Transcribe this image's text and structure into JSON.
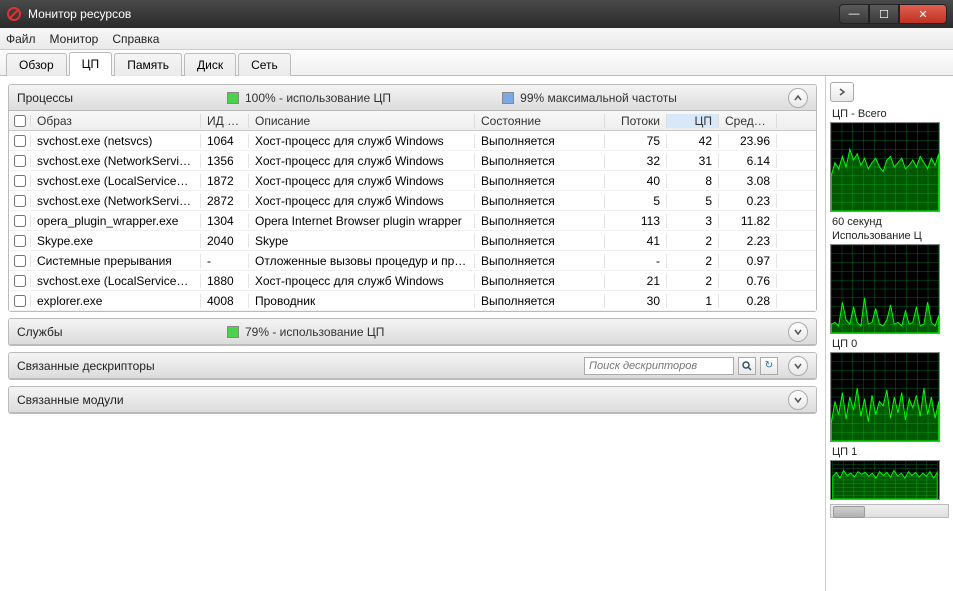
{
  "window": {
    "title": "Монитор ресурсов"
  },
  "menu": {
    "file": "Файл",
    "monitor": "Монитор",
    "help": "Справка"
  },
  "tabs": {
    "overview": "Обзор",
    "cpu": "ЦП",
    "memory": "Память",
    "disk": "Диск",
    "network": "Сеть"
  },
  "panels": {
    "processes": {
      "title": "Процессы",
      "stat1": "100% - использование ЦП",
      "stat2": "99% максимальной частоты",
      "columns": {
        "image": "Образ",
        "pid": "ИД п...",
        "desc": "Описание",
        "state": "Состояние",
        "threads": "Потоки",
        "cpu": "ЦП",
        "avg": "Средн..."
      },
      "rows": [
        {
          "image": "svchost.exe (netsvcs)",
          "pid": "1064",
          "desc": "Хост-процесс для служб Windows",
          "state": "Выполняется",
          "threads": "75",
          "cpu": "42",
          "avg": "23.96"
        },
        {
          "image": "svchost.exe (NetworkService)",
          "pid": "1356",
          "desc": "Хост-процесс для служб Windows",
          "state": "Выполняется",
          "threads": "32",
          "cpu": "31",
          "avg": "6.14"
        },
        {
          "image": "svchost.exe (LocalServiceAn...",
          "pid": "1872",
          "desc": "Хост-процесс для служб Windows",
          "state": "Выполняется",
          "threads": "40",
          "cpu": "8",
          "avg": "3.08"
        },
        {
          "image": "svchost.exe (NetworkService...",
          "pid": "2872",
          "desc": "Хост-процесс для служб Windows",
          "state": "Выполняется",
          "threads": "5",
          "cpu": "5",
          "avg": "0.23"
        },
        {
          "image": "opera_plugin_wrapper.exe",
          "pid": "1304",
          "desc": "Opera Internet Browser plugin wrapper",
          "state": "Выполняется",
          "threads": "113",
          "cpu": "3",
          "avg": "11.82"
        },
        {
          "image": "Skype.exe",
          "pid": "2040",
          "desc": "Skype",
          "state": "Выполняется",
          "threads": "41",
          "cpu": "2",
          "avg": "2.23"
        },
        {
          "image": "Системные прерывания",
          "pid": "-",
          "desc": "Отложенные вызовы процедур и про...",
          "state": "Выполняется",
          "threads": "-",
          "cpu": "2",
          "avg": "0.97"
        },
        {
          "image": "svchost.exe (LocalServiceNo...",
          "pid": "1880",
          "desc": "Хост-процесс для служб Windows",
          "state": "Выполняется",
          "threads": "21",
          "cpu": "2",
          "avg": "0.76"
        },
        {
          "image": "explorer.exe",
          "pid": "4008",
          "desc": "Проводник",
          "state": "Выполняется",
          "threads": "30",
          "cpu": "1",
          "avg": "0.28"
        }
      ]
    },
    "services": {
      "title": "Службы",
      "stat1": "79% - использование ЦП"
    },
    "handles": {
      "title": "Связанные дескрипторы",
      "search_placeholder": "Поиск дескрипторов"
    },
    "modules": {
      "title": "Связанные модули"
    }
  },
  "sidebar": {
    "graph1_title": "ЦП - Всего",
    "graph1_sub1": "60 секунд",
    "graph1_sub2": "Использование Ц",
    "graph2_title": "ЦП 0",
    "graph3_title": "ЦП 1"
  },
  "chart_data": [
    {
      "type": "area",
      "title": "ЦП - Всего",
      "xlabel": "60 секунд",
      "ylim": [
        0,
        100
      ],
      "values": [
        40,
        55,
        48,
        62,
        50,
        70,
        58,
        65,
        52,
        60,
        48,
        55,
        60,
        50,
        45,
        58,
        62,
        50,
        55,
        60,
        48,
        52,
        58,
        50,
        62,
        55,
        48,
        60,
        52,
        65
      ]
    },
    {
      "type": "area",
      "title": "Использование ЦП",
      "ylim": [
        0,
        100
      ],
      "values": [
        10,
        12,
        8,
        35,
        15,
        10,
        30,
        12,
        8,
        40,
        10,
        12,
        28,
        10,
        8,
        15,
        32,
        10,
        12,
        8,
        25,
        10,
        12,
        30,
        8,
        10,
        35,
        12,
        8,
        20
      ]
    },
    {
      "type": "area",
      "title": "ЦП 0",
      "ylim": [
        0,
        100
      ],
      "values": [
        20,
        45,
        30,
        55,
        25,
        50,
        35,
        60,
        28,
        48,
        22,
        52,
        30,
        45,
        40,
        58,
        26,
        50,
        32,
        55,
        24,
        48,
        38,
        52,
        28,
        60,
        30,
        50,
        26,
        45
      ]
    },
    {
      "type": "area",
      "title": "ЦП 1",
      "ylim": [
        0,
        100
      ],
      "values": [
        60,
        70,
        55,
        75,
        62,
        68,
        58,
        72,
        65,
        70,
        60,
        68,
        55,
        72,
        62,
        70,
        58,
        75,
        60,
        68,
        55,
        72,
        62,
        70,
        58,
        68,
        60,
        72,
        55,
        70
      ]
    }
  ]
}
